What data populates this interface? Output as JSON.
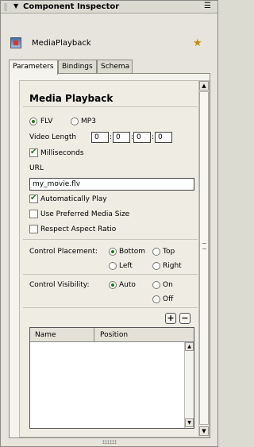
{
  "window": {
    "title": "Component Inspector",
    "menu_icon": "menu-icon"
  },
  "component": {
    "name": "MediaPlayback",
    "icon": "media-component-icon",
    "wizard_icon": "wizard-icon"
  },
  "tabs": [
    {
      "label": "Parameters",
      "active": true
    },
    {
      "label": "Bindings"
    },
    {
      "label": "Schema"
    }
  ],
  "panel": {
    "heading": "Media Playback",
    "format": {
      "options": [
        "FLV",
        "MP3"
      ],
      "selected": "FLV"
    },
    "video_length": {
      "label": "Video Length",
      "fields": [
        "0",
        "0",
        "0",
        "0"
      ],
      "separator": ":"
    },
    "milliseconds": {
      "label": "Milliseconds",
      "checked": true
    },
    "url": {
      "label": "URL",
      "value": "my_movie.flv"
    },
    "auto_play": {
      "label": "Automatically Play",
      "checked": true
    },
    "preferred_size": {
      "label": "Use Preferred Media Size",
      "checked": false
    },
    "aspect_ratio": {
      "label": "Respect Aspect Ratio",
      "checked": false
    },
    "placement": {
      "label": "Control Placement:",
      "options": [
        "Bottom",
        "Top",
        "Left",
        "Right"
      ],
      "selected": "Bottom"
    },
    "visibility": {
      "label": "Control Visibility:",
      "options": [
        "Auto",
        "On",
        "Off"
      ],
      "selected": "Auto"
    },
    "cue_buttons": {
      "add": "+",
      "remove": "−"
    },
    "cue_table": {
      "columns": [
        "Name",
        "Position"
      ],
      "rows": []
    }
  },
  "colors": {
    "selected_radio": "#1d7a1d",
    "check_mark": "#1d7a1d",
    "panel_bg": "#f4f3ee"
  }
}
